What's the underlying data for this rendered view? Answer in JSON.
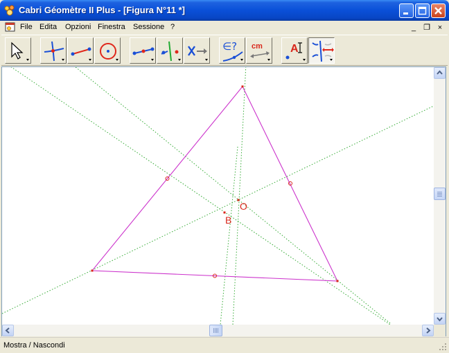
{
  "window": {
    "title": "Cabri Géomètre II Plus - [Figura N°11 *]",
    "controls": {
      "minimize": "minimize-icon",
      "maximize": "maximize-icon",
      "close": "close-icon"
    }
  },
  "menubar": {
    "items": [
      {
        "label": "File"
      },
      {
        "label": "Edita"
      },
      {
        "label": "Opzioni"
      },
      {
        "label": "Finestra"
      },
      {
        "label": "Sessione"
      },
      {
        "label": "?"
      }
    ],
    "mdi_controls": {
      "minimize": "_",
      "restore": "❐",
      "close": "×"
    }
  },
  "toolbar": {
    "tools": [
      {
        "icon": "pointer-arrow-icon"
      },
      {
        "icon": "point-on-intersection-icon"
      },
      {
        "icon": "segment-line-icon"
      },
      {
        "icon": "circle-icon"
      },
      {
        "icon": "construction-segment-icon"
      },
      {
        "icon": "perpendicular-line-icon"
      },
      {
        "icon": "transformation-icon"
      },
      {
        "icon": "property-check-icon"
      },
      {
        "icon": "measure-cm-icon",
        "text": "cm"
      },
      {
        "icon": "label-text-icon",
        "text": "A"
      },
      {
        "icon": "display-attributes-icon",
        "pressed": true
      }
    ]
  },
  "figure": {
    "points": [
      {
        "label": "O"
      },
      {
        "label": "B"
      }
    ],
    "colors": {
      "triangle": "#cc33cc",
      "lines": "#33aa33",
      "points": "#d8261a"
    }
  },
  "status": {
    "text": "Mostra / Nascondi"
  }
}
